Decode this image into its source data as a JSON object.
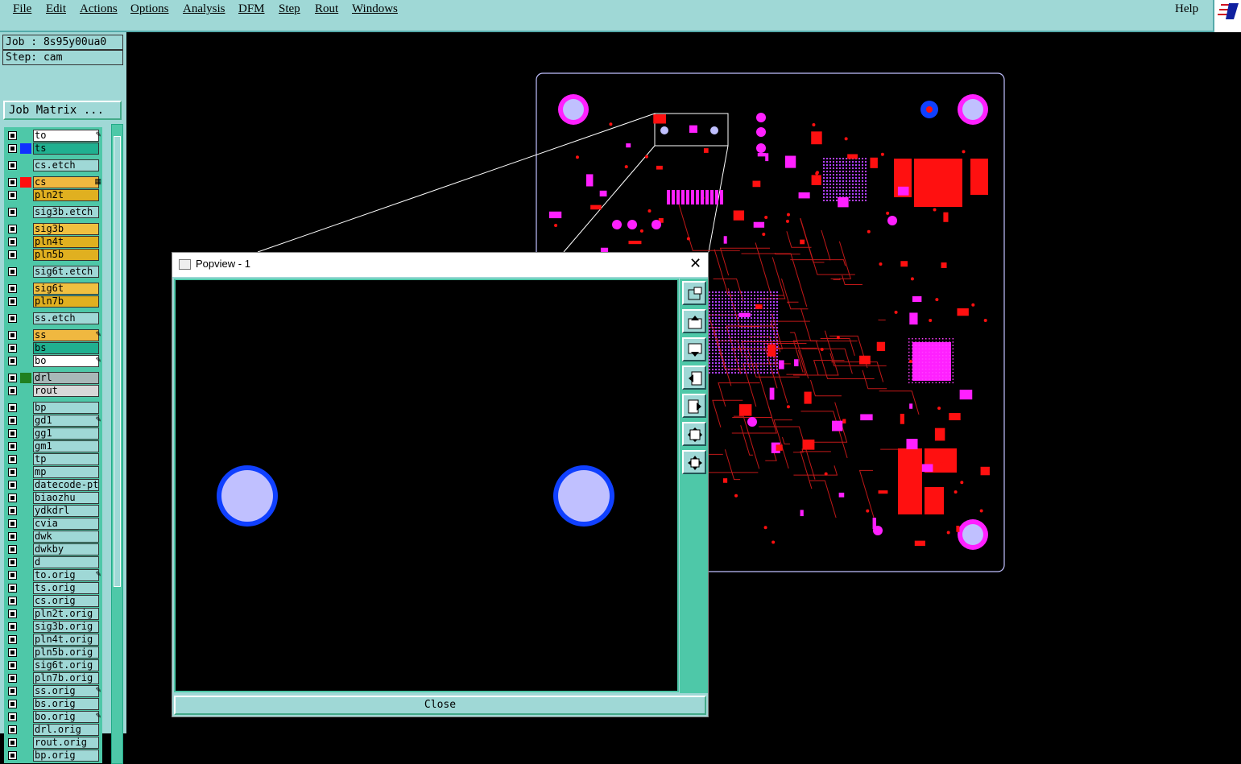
{
  "menubar": {
    "items": [
      "File",
      "Edit",
      "Actions",
      "Options",
      "Analysis",
      "DFM",
      "Step",
      "Rout",
      "Windows"
    ],
    "help": "Help"
  },
  "job": {
    "job_label": "Job : 8s95y00ua0",
    "step_label": "Step: cam",
    "matrix_button": "Job Matrix ..."
  },
  "layers": [
    {
      "name": "to",
      "bg": "#ffffff",
      "swatch": "",
      "mark": "✎"
    },
    {
      "name": "ts",
      "bg": "#20b090",
      "swatch": "#1030ff",
      "mark": ""
    },
    {
      "name": "cs.etch",
      "bg": "#9fd8d6",
      "swatch": "",
      "mark": ""
    },
    {
      "name": "cs",
      "bg": "#f0b840",
      "swatch": "#ff1010",
      "mark": "▦"
    },
    {
      "name": "pln2t",
      "bg": "#e0b020",
      "swatch": "",
      "mark": ""
    },
    {
      "name": "sig3b.etch",
      "bg": "#9fd8d6",
      "swatch": "",
      "mark": ""
    },
    {
      "name": "sig3b",
      "bg": "#f0c040",
      "swatch": "",
      "mark": ""
    },
    {
      "name": "pln4t",
      "bg": "#e0b020",
      "swatch": "",
      "mark": ""
    },
    {
      "name": "pln5b",
      "bg": "#e0b020",
      "swatch": "",
      "mark": ""
    },
    {
      "name": "sig6t.etch",
      "bg": "#9fd8d6",
      "swatch": "",
      "mark": ""
    },
    {
      "name": "sig6t",
      "bg": "#f0c040",
      "swatch": "",
      "mark": ""
    },
    {
      "name": "pln7b",
      "bg": "#e0b020",
      "swatch": "",
      "mark": ""
    },
    {
      "name": "ss.etch",
      "bg": "#9fd8d6",
      "swatch": "",
      "mark": ""
    },
    {
      "name": "ss",
      "bg": "#f0b840",
      "swatch": "",
      "mark": "✎"
    },
    {
      "name": "bs",
      "bg": "#20b090",
      "swatch": "",
      "mark": ""
    },
    {
      "name": "bo",
      "bg": "#ffffff",
      "swatch": "",
      "mark": "✎"
    },
    {
      "name": "drl",
      "bg": "#a8b8b8",
      "swatch": "#208020",
      "mark": ""
    },
    {
      "name": "rout",
      "bg": "#d8d8d8",
      "swatch": "",
      "mark": ""
    },
    {
      "name": "bp",
      "bg": "#9fd8d6",
      "swatch": "",
      "mark": ""
    },
    {
      "name": "gd1",
      "bg": "#9fd8d6",
      "swatch": "",
      "mark": "✎"
    },
    {
      "name": "gg1",
      "bg": "#9fd8d6",
      "swatch": "",
      "mark": ""
    },
    {
      "name": "gm1",
      "bg": "#9fd8d6",
      "swatch": "",
      "mark": ""
    },
    {
      "name": "tp",
      "bg": "#9fd8d6",
      "swatch": "",
      "mark": ""
    },
    {
      "name": "mp",
      "bg": "#9fd8d6",
      "swatch": "",
      "mark": ""
    },
    {
      "name": "datecode-pt",
      "bg": "#9fd8d6",
      "swatch": "",
      "mark": ""
    },
    {
      "name": "biaozhu",
      "bg": "#9fd8d6",
      "swatch": "",
      "mark": ""
    },
    {
      "name": "ydkdrl",
      "bg": "#9fd8d6",
      "swatch": "",
      "mark": ""
    },
    {
      "name": "cvia",
      "bg": "#9fd8d6",
      "swatch": "",
      "mark": ""
    },
    {
      "name": "dwk",
      "bg": "#9fd8d6",
      "swatch": "",
      "mark": ""
    },
    {
      "name": "dwkby",
      "bg": "#9fd8d6",
      "swatch": "",
      "mark": ""
    },
    {
      "name": "d",
      "bg": "#9fd8d6",
      "swatch": "",
      "mark": ""
    },
    {
      "name": "to.orig",
      "bg": "#9fd8d6",
      "swatch": "",
      "mark": "✎"
    },
    {
      "name": "ts.orig",
      "bg": "#9fd8d6",
      "swatch": "",
      "mark": ""
    },
    {
      "name": "cs.orig",
      "bg": "#9fd8d6",
      "swatch": "",
      "mark": ""
    },
    {
      "name": "pln2t.orig",
      "bg": "#9fd8d6",
      "swatch": "",
      "mark": ""
    },
    {
      "name": "sig3b.orig",
      "bg": "#9fd8d6",
      "swatch": "",
      "mark": ""
    },
    {
      "name": "pln4t.orig",
      "bg": "#9fd8d6",
      "swatch": "",
      "mark": ""
    },
    {
      "name": "pln5b.orig",
      "bg": "#9fd8d6",
      "swatch": "",
      "mark": ""
    },
    {
      "name": "sig6t.orig",
      "bg": "#9fd8d6",
      "swatch": "",
      "mark": ""
    },
    {
      "name": "pln7b.orig",
      "bg": "#9fd8d6",
      "swatch": "",
      "mark": ""
    },
    {
      "name": "ss.orig",
      "bg": "#9fd8d6",
      "swatch": "",
      "mark": "✎"
    },
    {
      "name": "bs.orig",
      "bg": "#9fd8d6",
      "swatch": "",
      "mark": ""
    },
    {
      "name": "bo.orig",
      "bg": "#9fd8d6",
      "swatch": "",
      "mark": "✎"
    },
    {
      "name": "drl.orig",
      "bg": "#9fd8d6",
      "swatch": "",
      "mark": ""
    },
    {
      "name": "rout.orig",
      "bg": "#9fd8d6",
      "swatch": "",
      "mark": ""
    },
    {
      "name": "bp.orig",
      "bg": "#9fd8d6",
      "swatch": "",
      "mark": ""
    }
  ],
  "popview": {
    "title": "Popview - 1",
    "close_label": "Close",
    "tools": [
      "zoom-window-icon",
      "pan-up-icon",
      "pan-down-icon",
      "pan-left-icon",
      "pan-right-icon",
      "fit-icon",
      "zoom-center-icon"
    ]
  },
  "colors": {
    "ui": "#9fd8d6",
    "pad": "#ff20ff",
    "copper": "#ff1010",
    "drill": "#c0c0ff",
    "drill_ring": "#1040ff"
  }
}
